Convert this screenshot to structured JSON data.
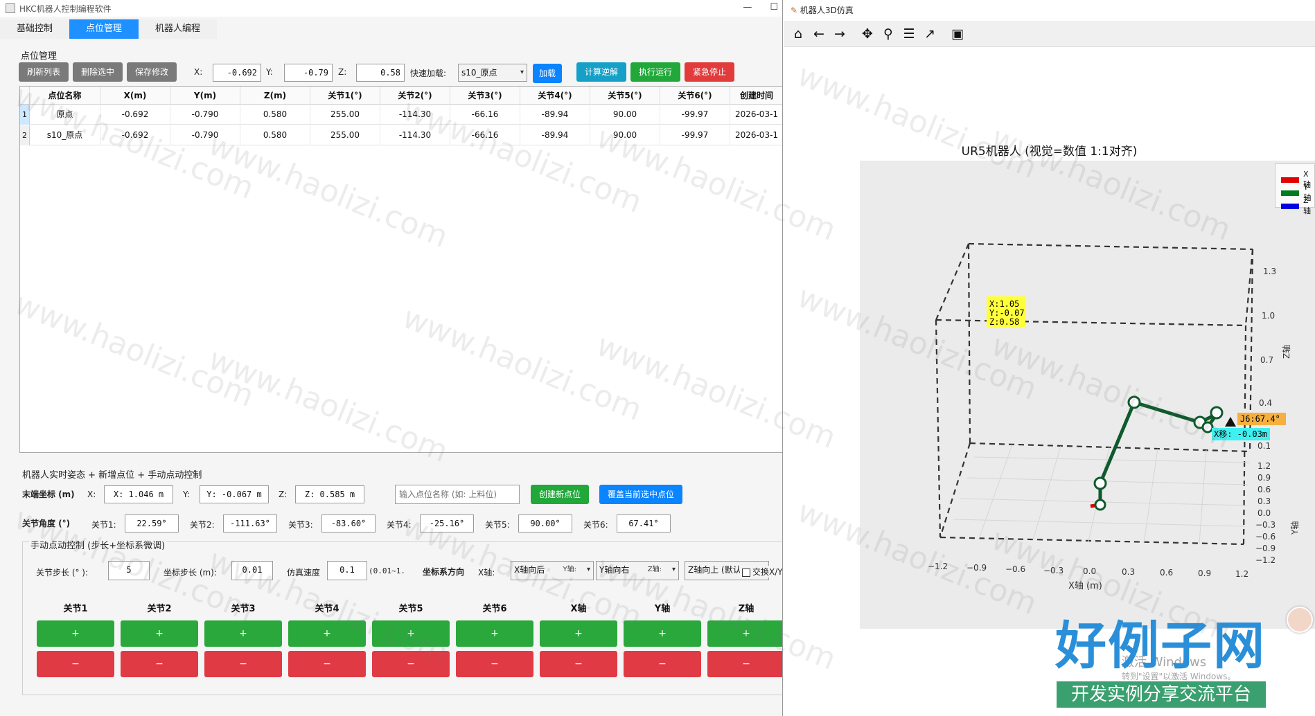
{
  "left_window": {
    "title": "HKC机器人控制编程软件",
    "tabs": [
      {
        "label": "基础控制"
      },
      {
        "label": "点位管理"
      },
      {
        "label": "机器人编程"
      }
    ],
    "point_group": {
      "title": "点位管理",
      "buttons": {
        "refresh": "刷新列表",
        "delete": "删除选中",
        "save": "保存修改",
        "load": "加载",
        "ik": "计算逆解",
        "run": "执行运行",
        "estop": "紧急停止"
      },
      "x_label": "X:",
      "x_value": "-0.692",
      "y_label": "Y:",
      "y_value": "-0.79",
      "z_label": "Z:",
      "z_value": "0.58",
      "quick_load_label": "快速加载:",
      "quick_load_value": "s10_原点"
    },
    "table": {
      "columns": [
        "点位名称",
        "X(m)",
        "Y(m)",
        "Z(m)",
        "关节1(°)",
        "关节2(°)",
        "关节3(°)",
        "关节4(°)",
        "关节5(°)",
        "关节6(°)",
        "创建时间"
      ],
      "rows": [
        {
          "num": "1",
          "cells": [
            "原点",
            "-0.692",
            "-0.790",
            "0.580",
            "255.00",
            "-114.30",
            "-66.16",
            "-89.94",
            "90.00",
            "-99.97",
            "2026-03-1"
          ]
        },
        {
          "num": "2",
          "cells": [
            "s10_原点",
            "-0.692",
            "-0.790",
            "0.580",
            "255.00",
            "-114.30",
            "-66.16",
            "-89.94",
            "90.00",
            "-99.97",
            "2026-03-1"
          ]
        }
      ]
    },
    "realtime_group": {
      "title": "机器人实时姿态 + 新增点位 + 手动点动控制",
      "end_coord_label": "末端坐标 (m)",
      "x_label": "X:",
      "x_value": "X: 1.046 m",
      "y_label": "Y:",
      "y_value": "Y: -0.067 m",
      "z_label": "Z:",
      "z_value": "Z: 0.585 m",
      "name_placeholder": "输入点位名称 (如: 上料位)",
      "create_btn": "创建新点位",
      "overwrite_btn": "覆盖当前选中点位",
      "joint_angle_label": "关节角度 (°)",
      "joints": [
        {
          "label": "关节1:",
          "value": "22.59°"
        },
        {
          "label": "关节2:",
          "value": "-111.63°"
        },
        {
          "label": "关节3:",
          "value": "-83.60°"
        },
        {
          "label": "关节4:",
          "value": "-25.16°"
        },
        {
          "label": "关节5:",
          "value": "90.00°"
        },
        {
          "label": "关节6:",
          "value": "67.41°"
        }
      ]
    },
    "jog_group": {
      "title": "手动点动控制 (步长+坐标系微调)",
      "joint_step_label": "关节步长 (° ):",
      "joint_step_value": "5",
      "coord_step_label": "坐标步长 (m):",
      "coord_step_value": "0.01",
      "sim_speed_label": "仿真速度",
      "sim_speed_value": "0.1",
      "sim_speed_range": "(0.01~1.",
      "coord_dir_label": "坐标系方向",
      "x_axis_label": "X轴:",
      "x_axis_value": "X轴向后",
      "y_axis_label": "Y轴:",
      "y_axis_value": "Y轴向右",
      "z_axis_label": "Z轴:",
      "z_axis_value": "Z轴向上 (默认",
      "swap_label": "交换X/Y",
      "columns": [
        "关节1",
        "关节2",
        "关节3",
        "关节4",
        "关节5",
        "关节6",
        "X轴",
        "Y轴",
        "Z轴"
      ],
      "plus": "+",
      "minus": "−"
    }
  },
  "right_window": {
    "title": "机器人3D仿真",
    "toolbar_icons": [
      "home-icon",
      "back-icon",
      "forward-icon",
      "pan-icon",
      "zoom-icon",
      "configure-icon",
      "edit-axis-icon",
      "save-icon"
    ],
    "plot_title": "UR5机器人 (视觉=数值 1:1对齐)",
    "legend": [
      {
        "label": "X轴",
        "color": "#e00000"
      },
      {
        "label": "Y轴",
        "color": "#007a1f"
      },
      {
        "label": "Z轴",
        "color": "#0000e0"
      }
    ],
    "annotation_pos": [
      "X:1.05",
      "Y:-0.07",
      "Z:0.58"
    ],
    "annotation_j6": "J6:67.4°",
    "annotation_move": "X移: -0.03m",
    "x_ticks": [
      "−1.2",
      "−0.9",
      "−0.6",
      "−0.3",
      "0.0",
      "0.3",
      "0.6",
      "0.9",
      "1.2"
    ],
    "x_axis_label": "X轴 (m)",
    "z_ticks": [
      "1.3",
      "1.0",
      "0.7",
      "0.4",
      "0.1"
    ],
    "z_axis_label": "Z轴",
    "y_ticks": [
      "1.2",
      "0.9",
      "0.6",
      "0.3",
      "0.0",
      "−0.3",
      "−0.6",
      "−0.9",
      "−1.2"
    ],
    "y_axis_label": "Y轴"
  },
  "overlay": {
    "brand_big": "好例子网",
    "brand_small": "开发实例分享交流平台",
    "win_activate": "激活 Windows",
    "win_activate_sub": "转到\"设置\"以激活 Windows。",
    "watermark": "www.haolizi.com"
  },
  "colors": {
    "accent": "#1e90ff",
    "green": "#22a83a",
    "red": "#e23b3b",
    "robot_link": "#0f5a2c"
  }
}
